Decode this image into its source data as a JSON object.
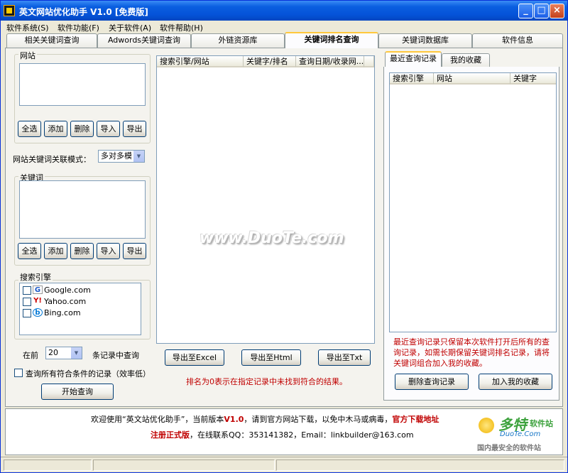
{
  "window": {
    "title": "英文网站优化助手 V1.0 [免费版]",
    "min_label": "_",
    "max_label": "□",
    "close_label": "×"
  },
  "menu": [
    "软件系统(S)",
    "软件功能(F)",
    "关于软件(A)",
    "软件帮助(H)"
  ],
  "tabs": [
    "相关关键词查询",
    "Adwords关键词查询",
    "外链资源库",
    "关键词排名查询",
    "关键词数据库",
    "软件信息"
  ],
  "left": {
    "site_group": "网站",
    "site_buttons": [
      "全选",
      "添加",
      "删除",
      "导入",
      "导出"
    ],
    "mode_label": "网站关键词关联模式：",
    "mode_value": "多对多模",
    "keyword_group": "关键词",
    "keyword_buttons": [
      "全选",
      "添加",
      "删除",
      "导入",
      "导出"
    ],
    "engine_group": "搜索引擎",
    "engines": [
      {
        "name": "Google.com",
        "icon": "google-icon"
      },
      {
        "name": "Yahoo.com",
        "icon": "yahoo-icon"
      },
      {
        "name": "Bing.com",
        "icon": "bing-icon"
      }
    ],
    "pre_label": "在前",
    "count_value": "20",
    "post_label": "条记录中查询",
    "all_label": "查询所有符合条件的记录（效率低）",
    "start_button": "开始查询"
  },
  "center": {
    "columns": [
      "搜索引擎/网站",
      "关键字/排名",
      "查询日期/收录网..."
    ],
    "watermark": "www.DuoTe.com",
    "export_buttons": [
      "导出至Excel",
      "导出至Html",
      "导出至Txt"
    ],
    "note": "排名为0表示在指定记录中未找到符合的结果。"
  },
  "right": {
    "tabs": [
      "最近查询记录",
      "我的收藏"
    ],
    "columns": [
      "搜索引擎",
      "网站",
      "关键字"
    ],
    "note": "最近查询记录只保留本次软件打开后所有的查询记录，如需长期保留关键词排名记录，请将关键词组合加入我的收藏。",
    "buttons": [
      "删除查询记录",
      "加入我的收藏"
    ]
  },
  "info": {
    "line1_a": "欢迎使用“英文站优化助手”，当前版本",
    "line1_version": "V1.0",
    "line1_b": "，请到官方网站下载，以免中木马或病毒，",
    "line1_link": "官方下载地址",
    "line2_reg": "注册正式版",
    "line2_b": "，在线联系QQ：353141382，Email：linkbuilder@163.com",
    "logo_text": "多特",
    "logo_sub": "软件站",
    "logo_url": "DuoTe.Com",
    "logo_slogan": "国内最安全的软件站"
  }
}
